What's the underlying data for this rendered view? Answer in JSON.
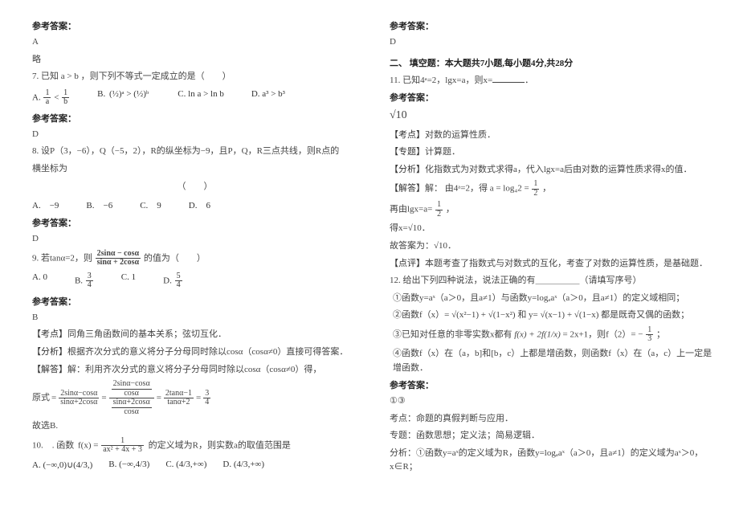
{
  "labels": {
    "ansref": "参考答案：",
    "brief": "略",
    "kaodian": "【考点】",
    "zhuanti": "【专题】",
    "fenxi": "【分析】",
    "jieda": "【解答】",
    "dianping": "【点评】",
    "yuanshi": "原式",
    "gushuB": "故选B.",
    "gudaan": "故答案为：",
    "jie": "解：",
    "kaodian_plain": "考点：",
    "zhuanti_plain": "专题：",
    "fenxi_plain": "分析："
  },
  "q6": {
    "ans": "A"
  },
  "q7": {
    "stem": "7. 已知 a > b ，则下列不等式一定成立的是（　　）",
    "A": "A.",
    "A_supL": "1",
    "A_supL_den": "a",
    "A_lt": "<",
    "A_supR": "1",
    "A_supR_den": "b",
    "B": "B.",
    "B_expr": "(½)ᵃ > (½)ᵇ",
    "C": "C.",
    "C_expr": "ln a > ln b",
    "D": "D.",
    "D_expr": "a³ > b³",
    "ans": "D"
  },
  "q8": {
    "stem1": "8. 设P（3，−6），Q（−5，2），R的纵坐标为−9，且P，Q，R三点共线，则R点的",
    "stem2": "横坐标为",
    "paren": "（　　）",
    "A": "A.　−9",
    "B": "B.　−6",
    "C": "C.　9",
    "D": "D.　6",
    "ans": "D"
  },
  "q9": {
    "stem_pre": "9. 若tanα=2，则",
    "stem_frac_num": "2sinα − cosα",
    "stem_frac_den": "sinα + 2cosα",
    "stem_post": "的值为（　　）",
    "A": "A. 0",
    "B_pre": "B.",
    "B_num": "3",
    "B_den": "4",
    "C": "C. 1",
    "D_pre": "D.",
    "D_num": "5",
    "D_den": "4",
    "ans": "B",
    "kaodian": "同角三角函数间的基本关系；弦切互化．",
    "fenxi": "根据齐次分式的意义将分子分母同时除以cosα（cosα≠0）直接可得答案．",
    "jieda_pre": "解：利用齐次分式的意义将分子分母同时除以cosα（cosα≠0）得，",
    "chain_a_num": "2sinα−cosα",
    "chain_a_den": "sinα+2cosα",
    "chain_b_num_num": "2sinα−cosα",
    "chain_b_num_den": "cosα",
    "chain_b_den_num": "sinα+2cosα",
    "chain_b_den_den": "cosα",
    "chain_c_num": "2tanα−1",
    "chain_c_den": "tanα+2",
    "chain_d_num": "3",
    "chain_d_den": "4"
  },
  "q10": {
    "stem_pre": "10.　. 函数",
    "func_num": "1",
    "func_den": "ax² + 4x + 3",
    "func_wrap": "f(x) = ",
    "stem_post": "的定义域为R，则实数a的取值范围是",
    "A_pre": "A.",
    "A": "(−∞,0)∪(4/3,",
    "A_end": ")",
    "B_pre": "B.",
    "B": "(−∞,",
    "B_mid": "4/3",
    "B_end": ")",
    "C_pre": "C.",
    "C": "(",
    "C_mid": "4/3",
    "C_end": ",+∞)",
    "D_pre": "D.",
    "D": "(",
    "D_mid": "4/3",
    "D_end": ",+∞)"
  },
  "right_top": {
    "ans": "D"
  },
  "section2": "二、 填空题：本大题共7小题,每小题4分,共28分",
  "q11": {
    "stem": "11. 已知4ᵃ=2，lgx=a，则x=",
    "ans": "√10",
    "kaodian": "对数的运算性质．",
    "zhuanti": "计算题．",
    "fenxi": "化指数式为对数式求得a，代入lgx=a后由对数的运算性质求得x的值．",
    "jieda_pre": "由4ᵃ=2，得",
    "jieda_expr": "a = log₄2 = ",
    "jieda_frac_num": "1",
    "jieda_frac_den": "2",
    "jieda_comma": "，",
    "zaiyu": "再由lgx=a=",
    "zaiyu_frac_num": "1",
    "zaiyu_frac_den": "2",
    "zaiyu_end": "，",
    "dex": "得x=",
    "dex_val": "√10",
    "dex_end": "．",
    "gudaan_val": "√10",
    "dianping": "本题考查了指数式与对数式的互化，考查了对数的运算性质，是基础题．"
  },
  "q12": {
    "stem": "12. 给出下列四种说法，说法正确的有＿＿＿＿＿（请填写序号）",
    "o1": "①函数y=aˣ（a＞0，且a≠1）与函数y=logₐaˣ（a＞0，且a≠1）的定义域相同；",
    "o2_pre": "②函数f（x）= ",
    "o2_a": "√(x²−1) + √(1−x²)",
    "o2_mid": " 和 y= ",
    "o2_b": "√(x−1) + √(1−x)",
    "o2_post": " 都是既奇又偶的函数；",
    "o3_pre": "③已知对任意的非零实数x都有",
    "o3_expr": "f(x) + 2f(1/x)",
    "o3_mid": "= 2x+1，则f（2）= −",
    "o3_frac_num": "1",
    "o3_frac_den": "3",
    "o3_end": "；",
    "o4": "④函数f（x）在（a，b]和[b，c）上都是增函数，则函数f（x）在（a，c）上一定是增函数．",
    "ans": "①③",
    "kaodian": "命题的真假判断与应用．",
    "zhuanti": "函数思想；定义法；简易逻辑．",
    "fenxi": "①函数y=aˣ的定义域为R，函数y=logₐaˣ（a＞0，且a≠1）的定义域为aˣ＞0，x∈R；"
  }
}
